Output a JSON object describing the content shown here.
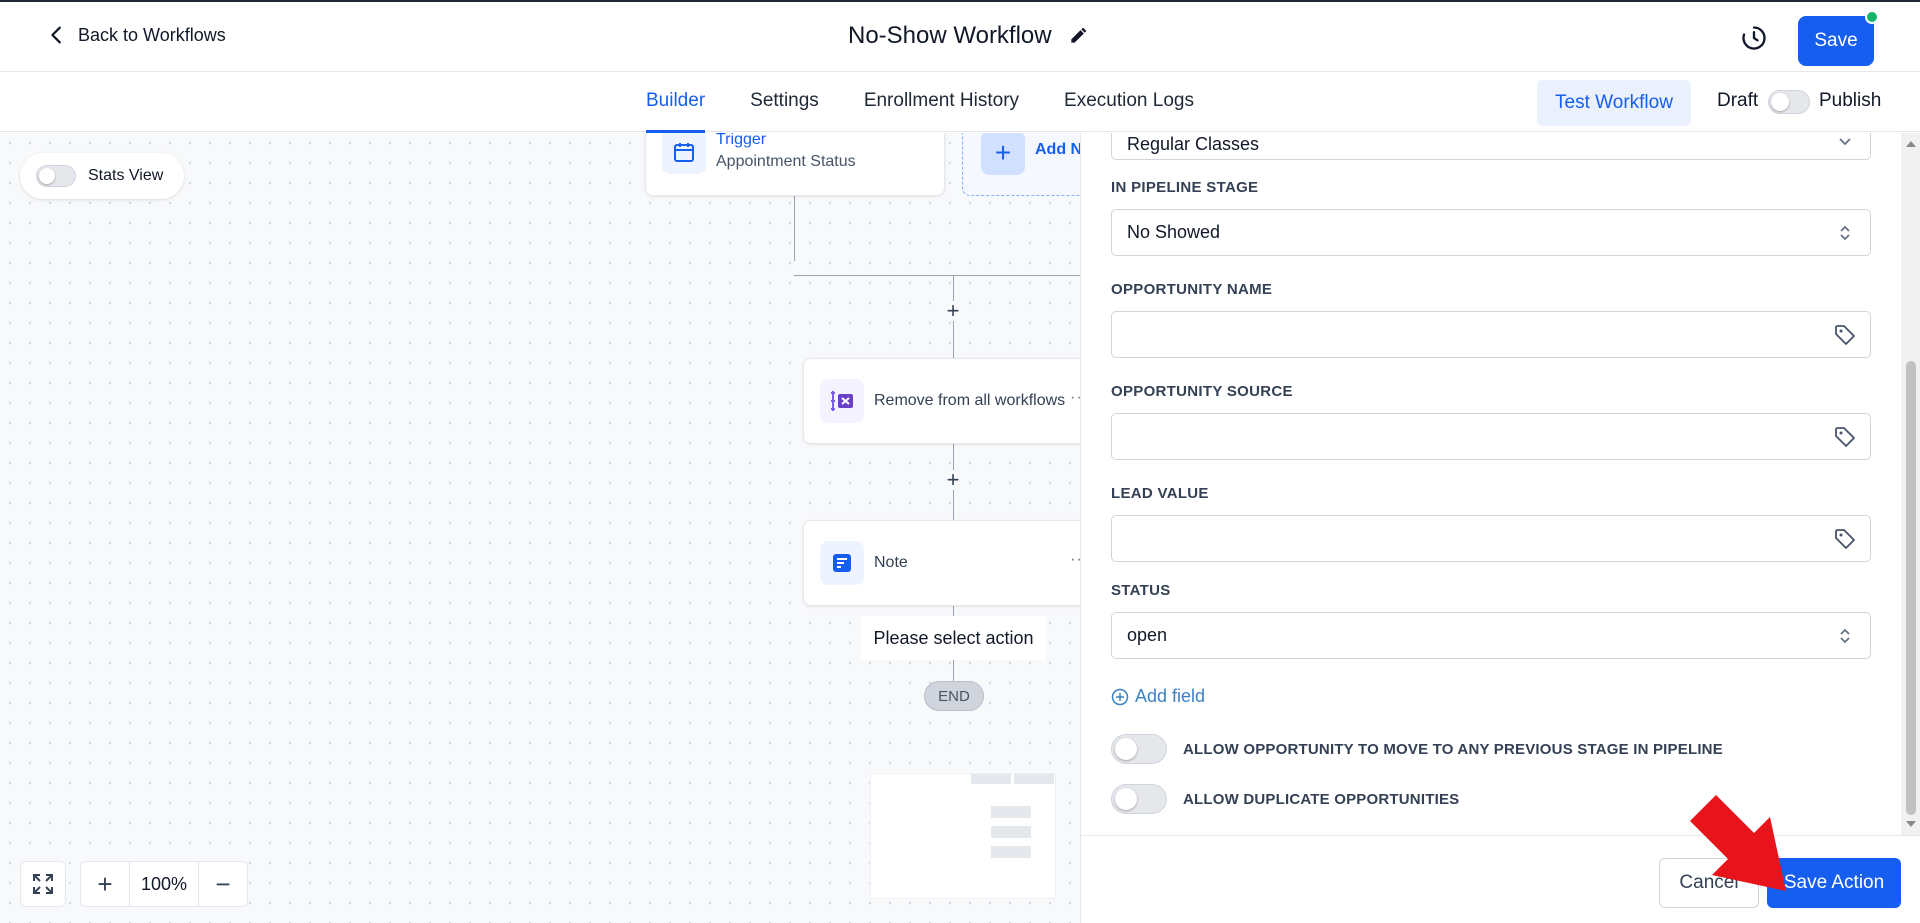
{
  "header": {
    "back_label": "Back to Workflows",
    "title": "No-Show Workflow",
    "save_label": "Save"
  },
  "tabs": [
    {
      "label": "Builder",
      "active": true
    },
    {
      "label": "Settings"
    },
    {
      "label": "Enrollment History"
    },
    {
      "label": "Execution Logs"
    }
  ],
  "toolbar": {
    "test_label": "Test Workflow",
    "draft_label": "Draft",
    "publish_label": "Publish"
  },
  "canvas": {
    "stats_label": "Stats View",
    "trigger_title": "Trigger",
    "trigger_subtitle": "Appointment Status",
    "add_new_label": "Add N",
    "remove_node_label": "Remove from all workflows",
    "note_node_label": "Note",
    "select_action_label": "Please select action",
    "end_label": "END",
    "zoom_level": "100%",
    "accent": "#155eef"
  },
  "panel": {
    "pipeline_value": "Regular Classes",
    "stage_label": "IN PIPELINE STAGE",
    "stage_value": "No Showed",
    "opp_name_label": "OPPORTUNITY NAME",
    "opp_name_value": "",
    "opp_source_label": "OPPORTUNITY SOURCE",
    "opp_source_value": "",
    "lead_value_label": "LEAD VALUE",
    "lead_value_value": "",
    "status_label": "STATUS",
    "status_value": "open",
    "add_field_label": "Add field",
    "toggle_prev_stage_label": "ALLOW OPPORTUNITY TO MOVE TO ANY PREVIOUS STAGE IN PIPELINE",
    "toggle_duplicates_label": "ALLOW DUPLICATE OPPORTUNITIES",
    "cancel_label": "Cancel",
    "save_action_label": "Save Action"
  }
}
